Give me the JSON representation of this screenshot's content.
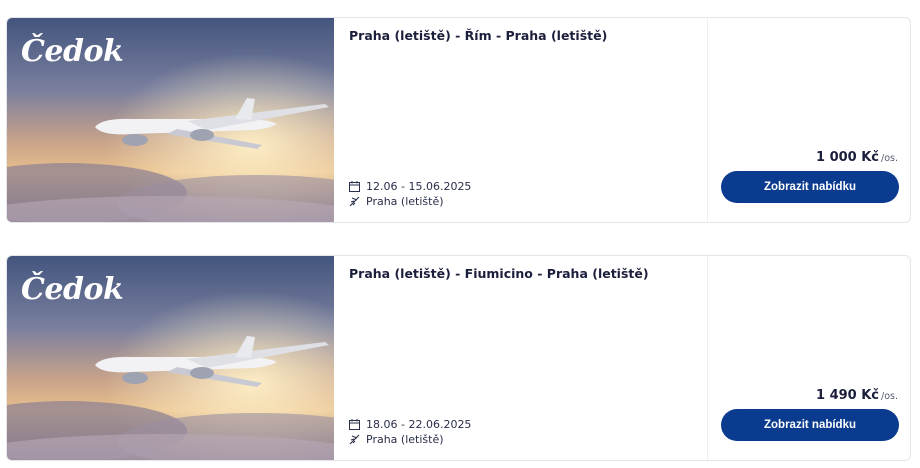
{
  "colors": {
    "button_bg": "#0b3b8f",
    "text_primary": "#1b1f3b",
    "card_border": "#e3e5ea"
  },
  "offers": [
    {
      "brand": "Čedok",
      "route": "Praha (letiště) - Řím - Praha (letiště)",
      "dates": "12.06 - 15.06.2025",
      "departure": "Praha (letiště)",
      "price": "1 000 Kč",
      "price_unit": "/os.",
      "cta": "Zobrazit nabídku"
    },
    {
      "brand": "Čedok",
      "route": "Praha (letiště) - Fiumicino - Praha (letiště)",
      "dates": "18.06 - 22.06.2025",
      "departure": "Praha (letiště)",
      "price": "1 490 Kč",
      "price_unit": "/os.",
      "cta": "Zobrazit nabídku"
    }
  ],
  "icons": {
    "date": "calendar-icon",
    "departure": "plane-departure-icon"
  }
}
